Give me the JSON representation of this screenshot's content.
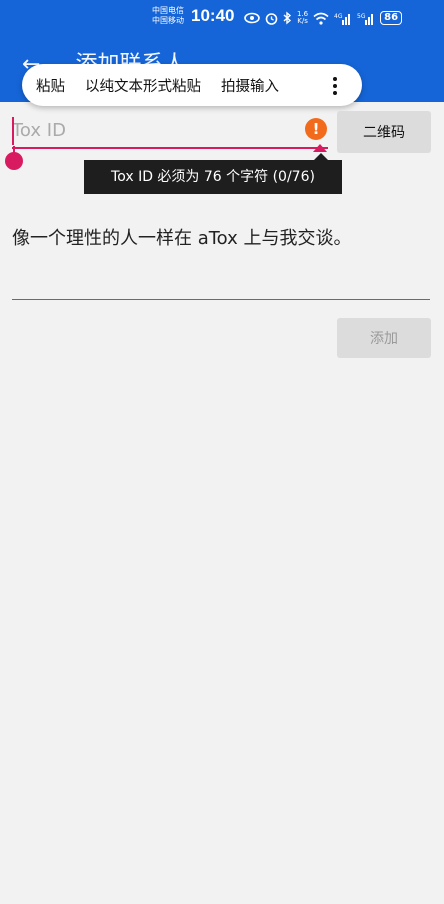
{
  "status": {
    "carrier1": "中国电信",
    "carrier2": "中国移动",
    "time": "10:40",
    "speed_value": "1.6",
    "speed_unit": "K/s",
    "net1": "4G",
    "net2": "5G",
    "battery": "86"
  },
  "appbar": {
    "title": "添加联系人"
  },
  "context_menu": {
    "items": [
      "粘贴",
      "以纯文本形式粘贴",
      "拍摄输入"
    ]
  },
  "tox_id": {
    "value": "",
    "placeholder": "Tox ID",
    "error_tooltip": "Tox ID 必须为 76 个字符 (0/76)"
  },
  "qr_button": "二维码",
  "message": {
    "value": "像一个理性的人一样在 aTox 上与我交谈。"
  },
  "add_button": "添加",
  "colors": {
    "appbar": "#1565d8",
    "accent": "#d81b60",
    "error": "#f26b1d",
    "background": "#f2f2f2"
  }
}
